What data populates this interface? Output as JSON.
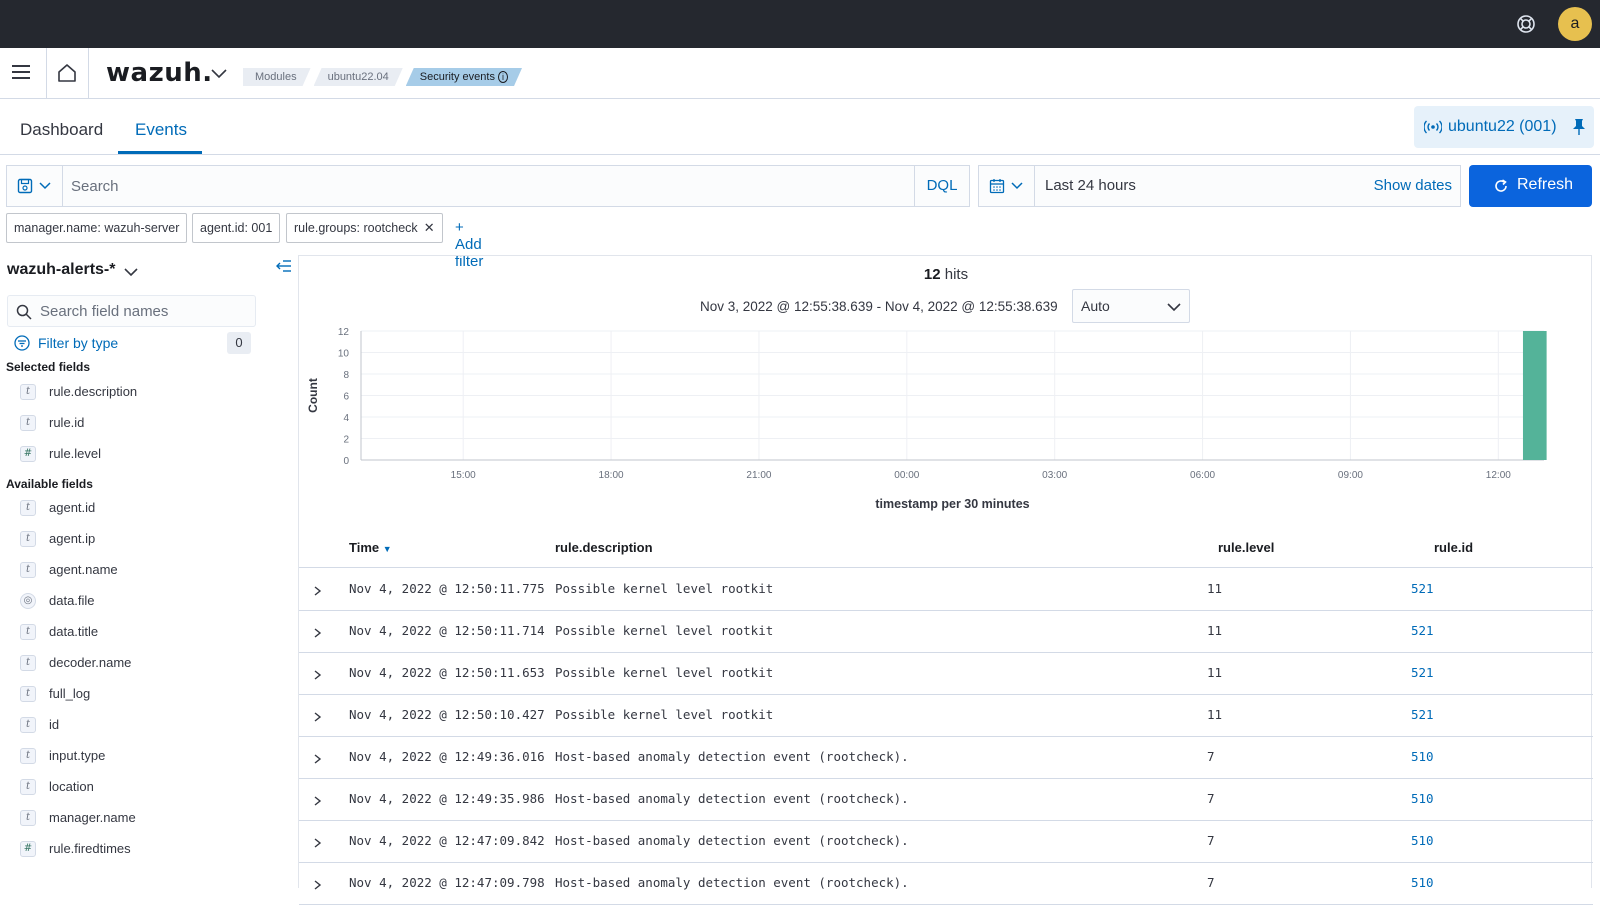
{
  "topbar": {
    "avatar_letter": "a"
  },
  "header": {
    "logo": "wazuh.",
    "breadcrumbs": [
      "Modules",
      "ubuntu22.04",
      "Security events"
    ]
  },
  "tabs": [
    {
      "label": "Dashboard",
      "active": false
    },
    {
      "label": "Events",
      "active": true
    }
  ],
  "agent": {
    "label": "ubuntu22 (001)"
  },
  "search": {
    "placeholder": "Search",
    "language": "DQL"
  },
  "time": {
    "range_label": "Last 24 hours",
    "show_dates": "Show dates",
    "refresh": "Refresh"
  },
  "filters": {
    "pills": [
      "manager.name: wazuh-server",
      "agent.id: 001",
      "rule.groups: rootcheck"
    ],
    "add_label": "+ Add filter"
  },
  "sidebar": {
    "index_pattern": "wazuh-alerts-*",
    "field_search_placeholder": "Search field names",
    "filter_by_type": "Filter by type",
    "filter_count": "0",
    "selected_title": "Selected fields",
    "selected_fields": [
      {
        "type": "t",
        "name": "rule.description"
      },
      {
        "type": "t",
        "name": "rule.id"
      },
      {
        "type": "#",
        "name": "rule.level"
      }
    ],
    "available_title": "Available fields",
    "available_fields": [
      {
        "type": "t",
        "name": "agent.id"
      },
      {
        "type": "t",
        "name": "agent.ip"
      },
      {
        "type": "t",
        "name": "agent.name"
      },
      {
        "type": "geo",
        "name": "data.file"
      },
      {
        "type": "t",
        "name": "data.title"
      },
      {
        "type": "t",
        "name": "decoder.name"
      },
      {
        "type": "t",
        "name": "full_log"
      },
      {
        "type": "t",
        "name": "id"
      },
      {
        "type": "t",
        "name": "input.type"
      },
      {
        "type": "t",
        "name": "location"
      },
      {
        "type": "t",
        "name": "manager.name"
      },
      {
        "type": "#",
        "name": "rule.firedtimes"
      }
    ]
  },
  "histogram": {
    "hits": "12",
    "hits_label": "hits",
    "range": "Nov 3, 2022 @ 12:55:38.639 - Nov 4, 2022 @ 12:55:38.639",
    "interval": "Auto"
  },
  "chart_data": {
    "type": "bar",
    "ylabel": "Count",
    "xlabel": "timestamp per 30 minutes",
    "ylim": [
      0,
      12
    ],
    "y_ticks": [
      0,
      2,
      4,
      6,
      8,
      10,
      12
    ],
    "x_ticks": [
      "15:00",
      "18:00",
      "21:00",
      "00:00",
      "03:00",
      "06:00",
      "09:00",
      "12:00"
    ],
    "bars": [
      {
        "x": "12:30",
        "value": 12
      }
    ],
    "bar_color": "#54b399",
    "grid": true
  },
  "table": {
    "columns": [
      "Time",
      "rule.description",
      "rule.level",
      "rule.id"
    ],
    "rows": [
      [
        "Nov 4, 2022 @ 12:50:11.775",
        "Possible kernel level rootkit",
        "11",
        "521"
      ],
      [
        "Nov 4, 2022 @ 12:50:11.714",
        "Possible kernel level rootkit",
        "11",
        "521"
      ],
      [
        "Nov 4, 2022 @ 12:50:11.653",
        "Possible kernel level rootkit",
        "11",
        "521"
      ],
      [
        "Nov 4, 2022 @ 12:50:10.427",
        "Possible kernel level rootkit",
        "11",
        "521"
      ],
      [
        "Nov 4, 2022 @ 12:49:36.016",
        "Host-based anomaly detection event (rootcheck).",
        "7",
        "510"
      ],
      [
        "Nov 4, 2022 @ 12:49:35.986",
        "Host-based anomaly detection event (rootcheck).",
        "7",
        "510"
      ],
      [
        "Nov 4, 2022 @ 12:47:09.842",
        "Host-based anomaly detection event (rootcheck).",
        "7",
        "510"
      ],
      [
        "Nov 4, 2022 @ 12:47:09.798",
        "Host-based anomaly detection event (rootcheck).",
        "7",
        "510"
      ]
    ]
  }
}
